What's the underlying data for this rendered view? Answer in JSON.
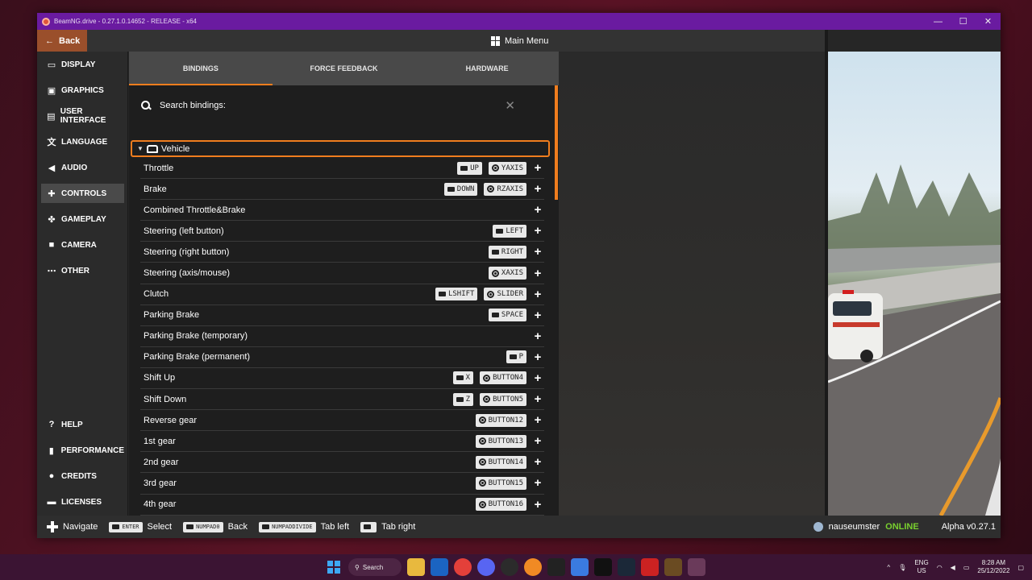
{
  "window": {
    "title": "BeamNG.drive - 0.27.1.0.14652 - RELEASE - x64",
    "controls": [
      "—",
      "☐",
      "✕"
    ]
  },
  "topbar": {
    "back_label": "Back",
    "main_menu_label": "Main Menu"
  },
  "sidebar": {
    "items": [
      {
        "label": "DISPLAY",
        "icon": "monitor-icon"
      },
      {
        "label": "GRAPHICS",
        "icon": "image-icon"
      },
      {
        "label": "USER INTERFACE",
        "icon": "window-icon"
      },
      {
        "label": "LANGUAGE",
        "icon": "translate-icon"
      },
      {
        "label": "AUDIO",
        "icon": "speaker-icon"
      },
      {
        "label": "CONTROLS",
        "icon": "gamepad-icon",
        "active": true
      },
      {
        "label": "GAMEPLAY",
        "icon": "puzzle-icon"
      },
      {
        "label": "CAMERA",
        "icon": "camera-icon"
      },
      {
        "label": "OTHER",
        "icon": "dots-icon"
      }
    ],
    "bottom_items": [
      {
        "label": "HELP",
        "icon": "help-icon"
      },
      {
        "label": "PERFORMANCE",
        "icon": "chart-icon"
      },
      {
        "label": "CREDITS",
        "icon": "people-icon"
      },
      {
        "label": "LICENSES",
        "icon": "license-icon"
      }
    ]
  },
  "tabs": [
    {
      "label": "BINDINGS",
      "active": true
    },
    {
      "label": "FORCE FEEDBACK"
    },
    {
      "label": "HARDWARE"
    }
  ],
  "search": {
    "placeholder": "Search bindings:"
  },
  "category": {
    "label": "Vehicle"
  },
  "bindings": [
    {
      "action": "Throttle",
      "keyboard": "UP",
      "controller": "YAXIS"
    },
    {
      "action": "Brake",
      "keyboard": "DOWN",
      "controller": "RZAXIS"
    },
    {
      "action": "Combined Throttle&Brake"
    },
    {
      "action": "Steering (left button)",
      "keyboard": "LEFT"
    },
    {
      "action": "Steering (right button)",
      "keyboard": "RIGHT"
    },
    {
      "action": "Steering (axis/mouse)",
      "controller": "XAXIS"
    },
    {
      "action": "Clutch",
      "keyboard": "LSHIFT",
      "controller": "SLIDER"
    },
    {
      "action": "Parking Brake",
      "keyboard": "SPACE"
    },
    {
      "action": "Parking Brake (temporary)"
    },
    {
      "action": "Parking Brake (permanent)",
      "keyboard": "P"
    },
    {
      "action": "Shift Up",
      "keyboard": "X",
      "controller": "BUTTON4"
    },
    {
      "action": "Shift Down",
      "keyboard": "Z",
      "controller": "BUTTON5"
    },
    {
      "action": "Reverse gear",
      "controller": "BUTTON12"
    },
    {
      "action": "1st gear",
      "controller": "BUTTON13"
    },
    {
      "action": "2nd gear",
      "controller": "BUTTON14"
    },
    {
      "action": "3rd gear",
      "controller": "BUTTON15"
    },
    {
      "action": "4th gear",
      "controller": "BUTTON16"
    }
  ],
  "bottombar": {
    "navigate_label": "Navigate",
    "hints": [
      {
        "key": "ENTER",
        "label": "Select"
      },
      {
        "key": "NUMPAD0",
        "label": "Back"
      },
      {
        "key": "NUMPADDIVIDE",
        "label": "Tab left"
      },
      {
        "key": "",
        "label": "Tab right"
      }
    ],
    "username": "nauseumster",
    "status": "ONLINE",
    "version": "Alpha v0.27.1"
  },
  "taskbar": {
    "search_label": "Search",
    "language": "ENG",
    "region": "US",
    "time": "8:28 AM",
    "date": "25/12/2022"
  },
  "colors": {
    "accent": "#f07d1e",
    "titlebar": "#6a1ba0",
    "online": "#79d02f",
    "back_button": "#9a4f2b"
  }
}
